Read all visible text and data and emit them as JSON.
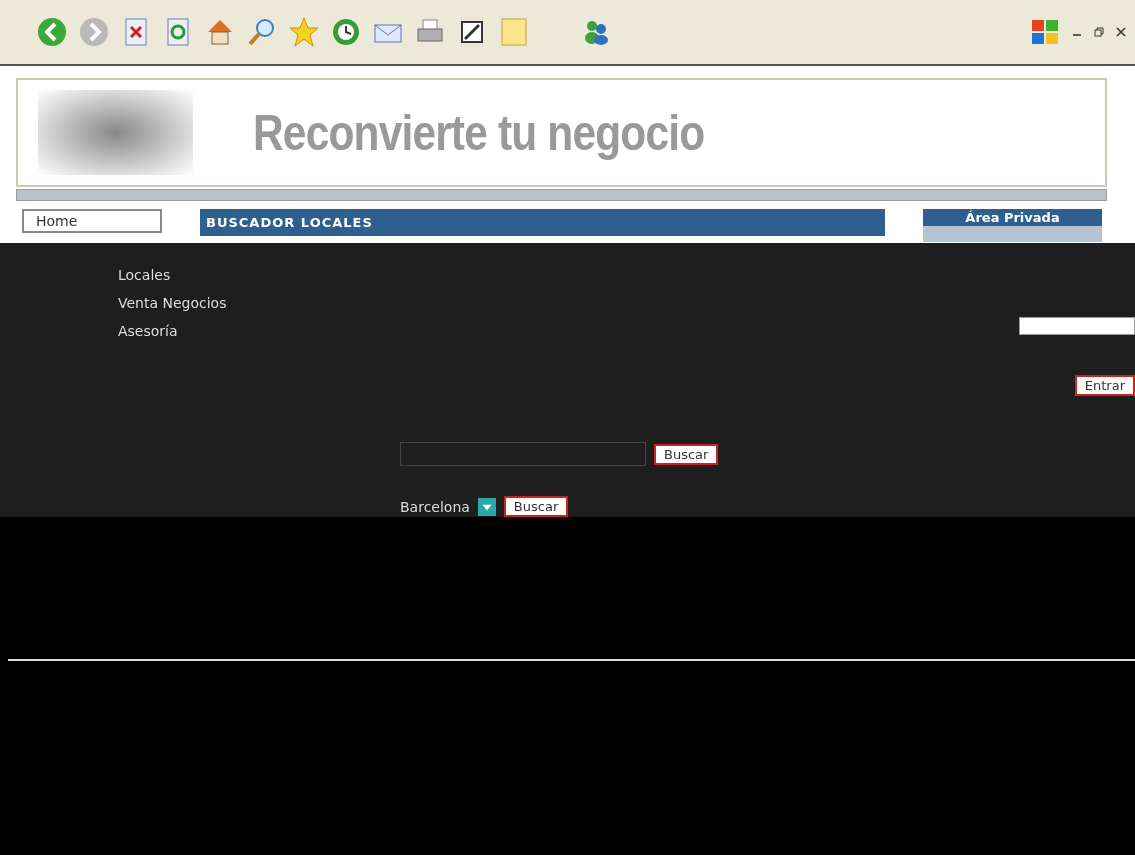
{
  "banner": {
    "title": "Reconvierte tu negocio"
  },
  "menu": [
    {
      "label": "Home"
    },
    {
      "label": "Locales"
    },
    {
      "label": "Venta Negocios"
    },
    {
      "label": "Asesoría"
    }
  ],
  "search_panel": {
    "title": "BUSCADOR LOCALES",
    "rows": [
      {
        "kind": "text",
        "button": "Buscar"
      },
      {
        "kind": "select",
        "value": "Barcelona",
        "button": "Buscar"
      }
    ]
  },
  "private_area": {
    "title": "Área Privada",
    "button": "Entrar"
  }
}
